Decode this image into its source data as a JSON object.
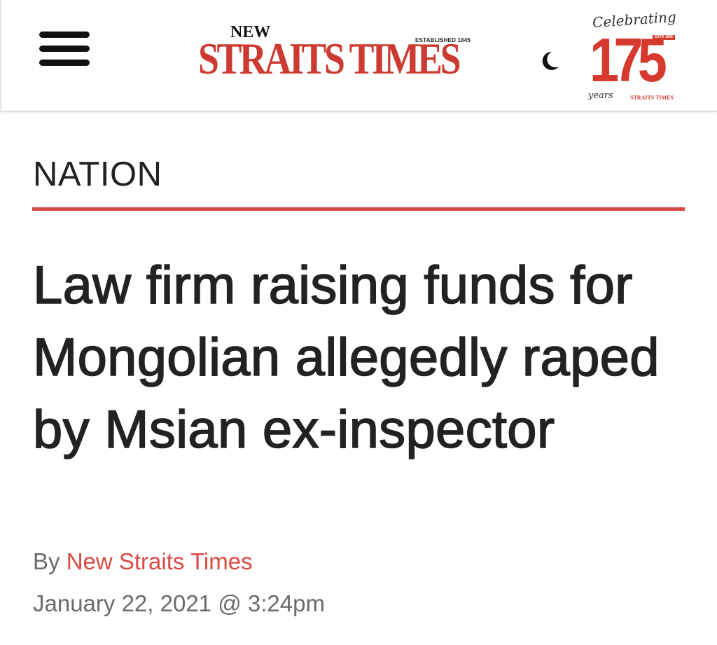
{
  "header": {
    "menu_icon": "hamburger-menu-icon",
    "logo": {
      "new": "NEW",
      "established": "ESTABLISHED 1845",
      "name": "STRAITS TIMES"
    },
    "theme_icon": "crescent-moon-icon",
    "badge": {
      "celebrating": "Celebrating",
      "number": "175",
      "tag": "ESTD 1845",
      "years": "years",
      "brand": "STRAITS TIMES"
    }
  },
  "article": {
    "section": "NATION",
    "headline": "Law firm raising funds for Mongolian allegedly raped by Msian ex-inspector",
    "byline_prefix": "By",
    "author": "New Straits Times",
    "date": "January 22, 2021 @ 3:24pm"
  },
  "colors": {
    "brand_red": "#cc3a31",
    "rule_red": "#d84a42",
    "text": "#222222",
    "meta_gray": "#6b6b6b"
  }
}
